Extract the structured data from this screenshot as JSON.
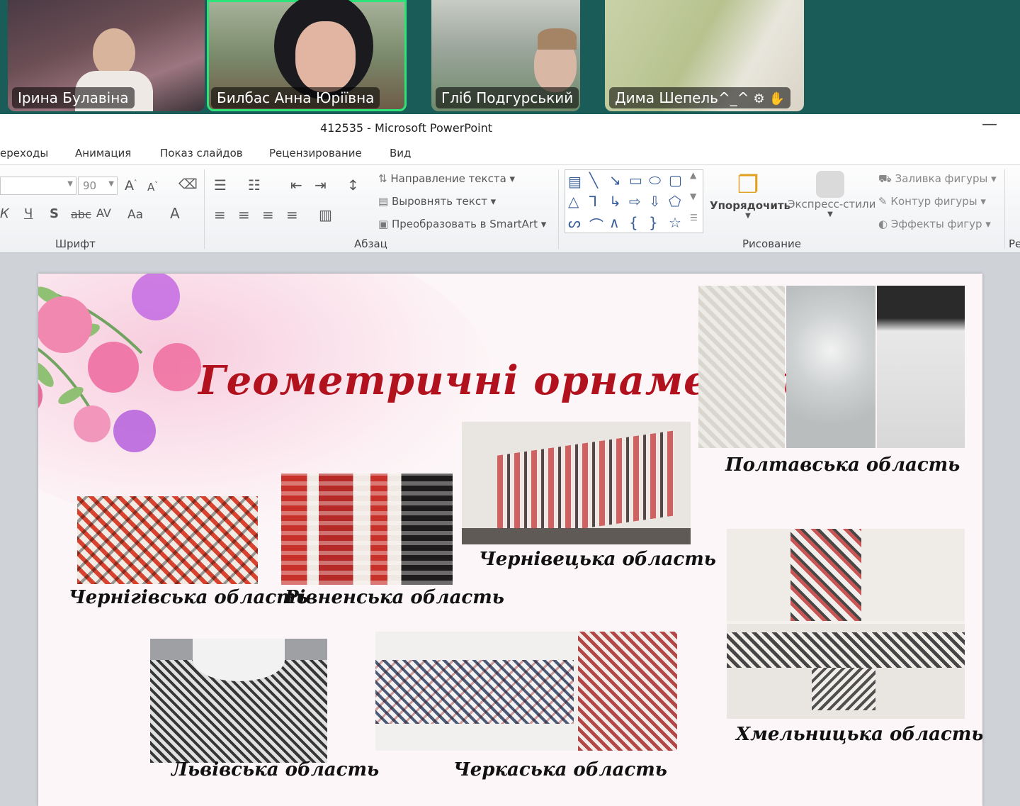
{
  "participants": [
    {
      "name": "Ірина Булавіна",
      "active": false
    },
    {
      "name": "Билбас Анна Юріївна",
      "active": true
    },
    {
      "name": "Гліб Подгурський",
      "active": false
    },
    {
      "name": "Дима Шепель^_^",
      "active": false,
      "icons": [
        "mic-muted-icon",
        "raised-hand-icon"
      ]
    }
  ],
  "window": {
    "title": "412535  -  Microsoft PowerPoint",
    "minimize": "—"
  },
  "tabs": [
    "ереходы",
    "Анимация",
    "Показ слайдов",
    "Рецензирование",
    "Вид"
  ],
  "ribbon": {
    "font_size": "90",
    "groups": {
      "font": "Шрифт",
      "paragraph": "Абзац",
      "drawing": "Рисование",
      "right_cut": "Ре"
    },
    "text_direction": "Направление текста",
    "align_text": "Выровнять текст",
    "convert_smartart": "Преобразовать в SmartArt",
    "arrange": "Упорядочить",
    "quick_styles": "Экспресс-стили",
    "shape_fill": "Заливка фигуры",
    "shape_outline": "Контур фигуры",
    "shape_effects": "Эффекты фигур"
  },
  "slide": {
    "title": "Геометричні орнаменти",
    "captions": {
      "poltava": "Полтавська область",
      "chernivtsi": "Чернівецька область",
      "chernihiv": "Чернігівська область",
      "rivne": "Рівненська область",
      "khmelnytskyi": "Хмельницька область",
      "lviv": "Львівська область",
      "cherkasy": "Черкаська область"
    }
  },
  "colors": {
    "teal_bg": "#1a5d58",
    "active_border": "#2ee27a",
    "title_red": "#b1121e"
  }
}
